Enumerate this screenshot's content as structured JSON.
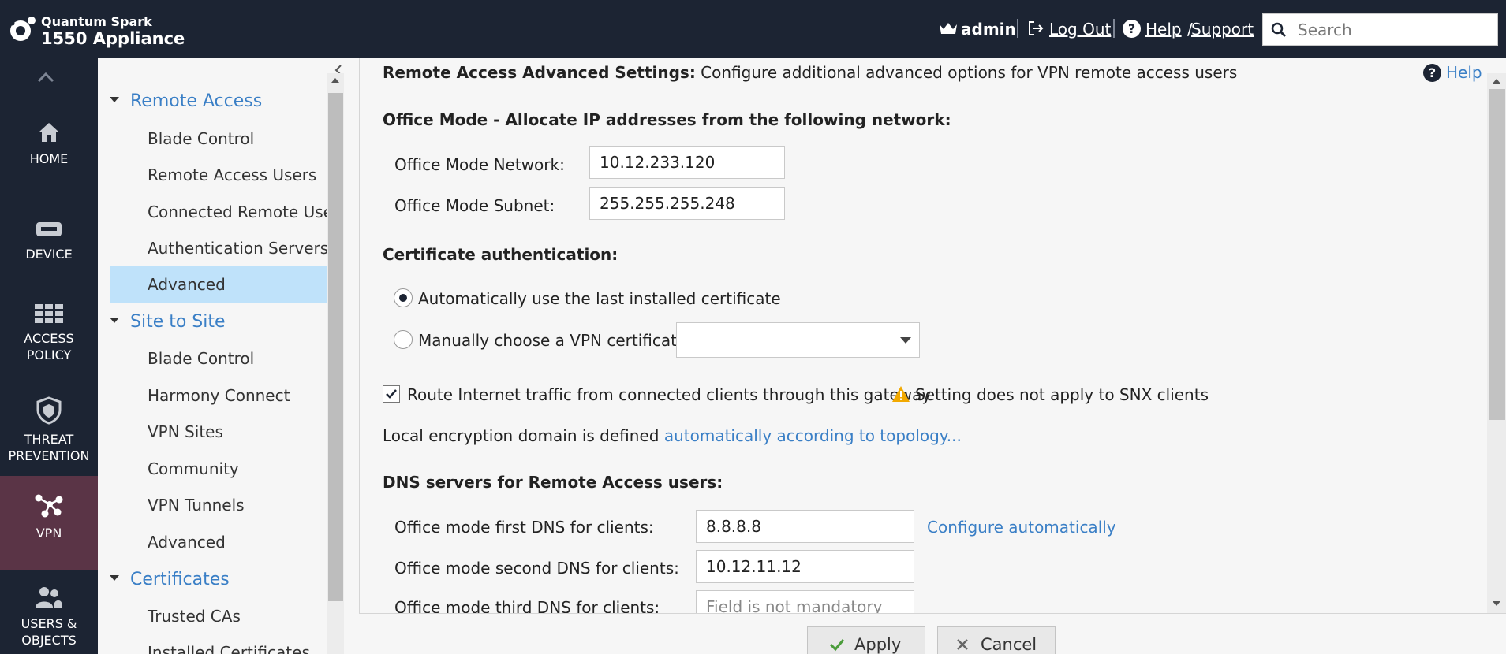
{
  "app": {
    "brand_line1": "Quantum Spark",
    "brand_line2": "1550 Appliance"
  },
  "topbar": {
    "user": "admin",
    "logout": "Log Out",
    "help": "Help",
    "slash": "/",
    "support": "Support",
    "search_placeholder": "Search",
    "search_value": ""
  },
  "nav": {
    "items": [
      {
        "id": "home",
        "label": "HOME",
        "icon": "home-icon"
      },
      {
        "id": "device",
        "label": "DEVICE",
        "icon": "device-icon"
      },
      {
        "id": "access",
        "label_line1": "ACCESS",
        "label_line2": "POLICY",
        "icon": "firewall-icon"
      },
      {
        "id": "threat",
        "label_line1": "THREAT",
        "label_line2": "PREVENTION",
        "icon": "shield-icon"
      },
      {
        "id": "vpn",
        "label": "VPN",
        "icon": "vpn-icon",
        "active": true
      },
      {
        "id": "users",
        "label_line1": "USERS &",
        "label_line2": "OBJECTS",
        "icon": "users-icon"
      }
    ]
  },
  "tree": {
    "groups": [
      {
        "label": "Remote Access",
        "items": [
          "Blade Control",
          "Remote Access Users",
          "Connected Remote Users",
          "Authentication Servers",
          "Advanced"
        ]
      },
      {
        "label": "Site to Site",
        "items": [
          "Blade Control",
          "Harmony Connect",
          "VPN Sites",
          "Community",
          "VPN Tunnels",
          "Advanced"
        ]
      },
      {
        "label": "Certificates",
        "items": [
          "Trusted CAs",
          "Installed Certificates"
        ]
      }
    ],
    "selected": "Remote Access > Advanced"
  },
  "main": {
    "heading_bold": "Remote Access Advanced Settings:",
    "heading_rest": " Configure additional advanced options for VPN remote access users",
    "help": "Help",
    "office_mode_title": "Office Mode - Allocate IP addresses from the following network:",
    "office_network_label": "Office Mode Network:",
    "office_network_value": "10.12.233.120",
    "office_subnet_label": "Office Mode Subnet:",
    "office_subnet_value": "255.255.255.248",
    "cert_title": "Certificate authentication:",
    "cert_auto_label": "Automatically use the last installed certificate",
    "cert_auto_selected": true,
    "cert_manual_label": "Manually choose a VPN certificate:",
    "cert_manual_value": "",
    "route_label": "Route Internet traffic from connected clients through this gateway",
    "route_checked": true,
    "route_warning": "Setting does not apply to SNX clients",
    "encryption_text": "Local encryption domain is defined ",
    "encryption_link": "automatically according to topology...",
    "dns_title": "DNS servers for Remote Access users:",
    "dns1_label": "Office mode first DNS for clients:",
    "dns1_value": "8.8.8.8",
    "dns_auto_link": "Configure automatically",
    "dns2_label": "Office mode second DNS for clients:",
    "dns2_value": "10.12.11.12",
    "dns3_label": "Office mode third DNS for clients:",
    "dns3_placeholder": "Field is not mandatory"
  },
  "footer": {
    "apply": "Apply",
    "cancel": "Cancel"
  },
  "colors": {
    "topbar": "#1c2433",
    "vpn_active": "#5a3446",
    "link": "#3a7fc6",
    "selected_row": "#bfe2fa",
    "warning": "#f2a900"
  }
}
